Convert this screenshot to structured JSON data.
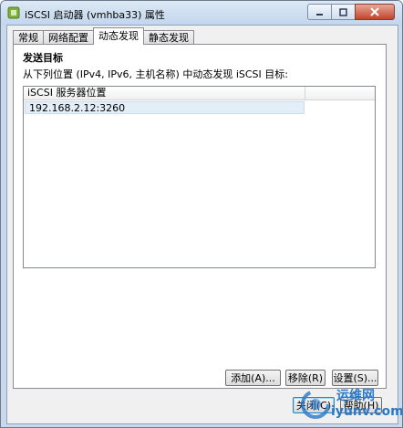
{
  "window": {
    "title": "iSCSI 启动器 (vmhba33) 属性"
  },
  "tabs": [
    {
      "label": "常规"
    },
    {
      "label": "网络配置"
    },
    {
      "label": "动态发现"
    },
    {
      "label": "静态发现"
    }
  ],
  "panel": {
    "group_title": "发送目标",
    "description": "从下列位置 (IPv4, IPv6, 主机名称) 中动态发现 iSCSI 目标:",
    "list": {
      "column_header": "iSCSI 服务器位置",
      "rows": [
        "192.168.2.12:3260"
      ]
    },
    "buttons": {
      "add": "添加(A)...",
      "remove": "移除(R)",
      "settings": "设置(S)..."
    }
  },
  "footer": {
    "close": "关闭(C)",
    "help": "帮助(H)"
  },
  "watermark": {
    "brand": "运维网",
    "url": "iyunv.com"
  },
  "colors": {
    "accent": "#3c7fb1",
    "watermark": "#2a78c8",
    "selection": "#e4eef9"
  }
}
